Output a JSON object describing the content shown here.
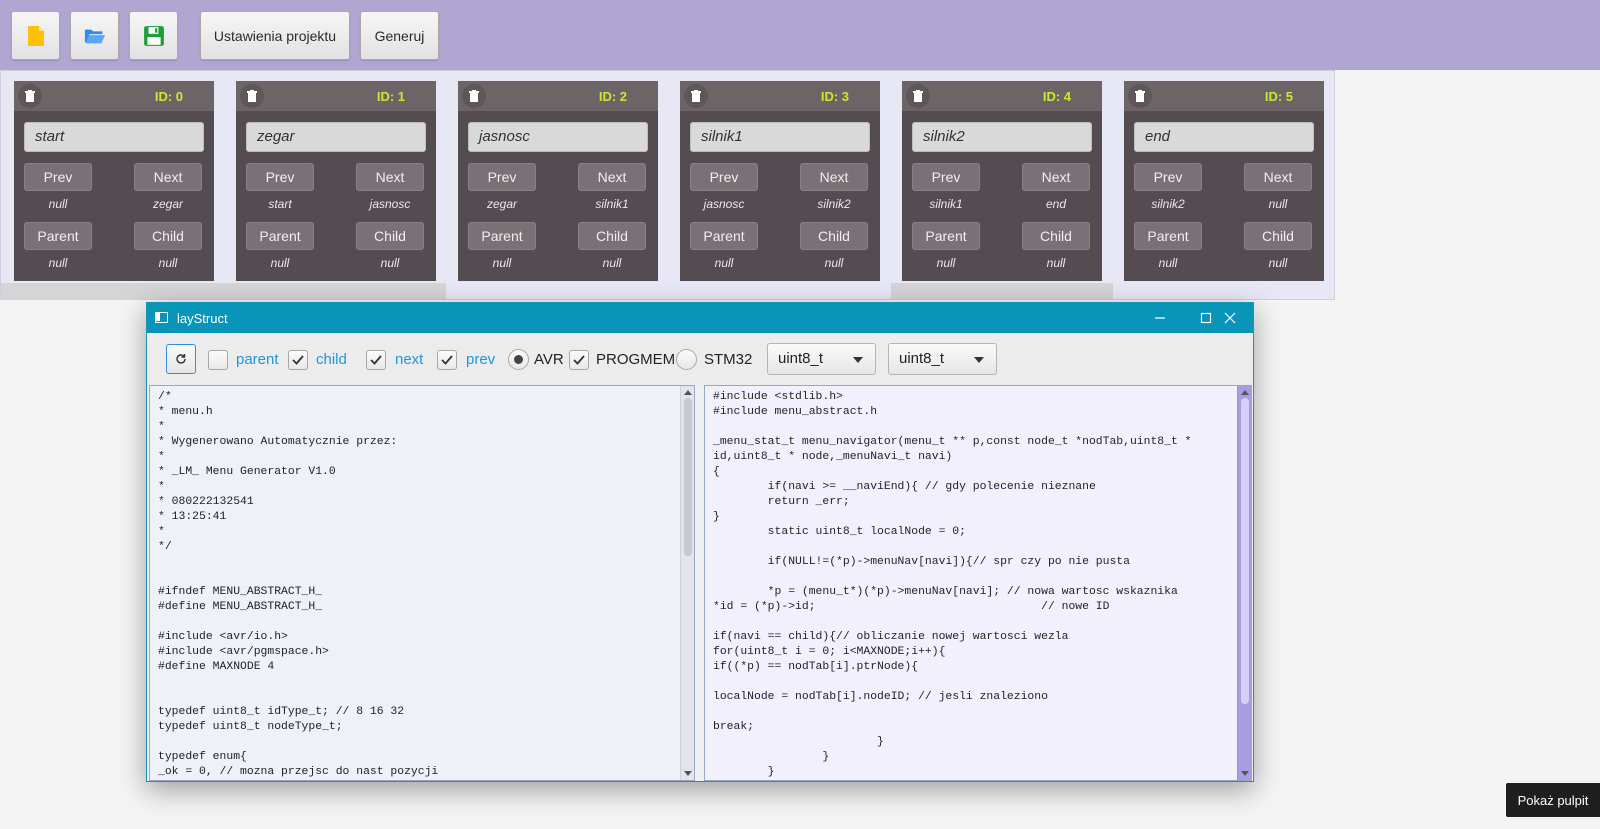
{
  "toolbar": {
    "new_icon_color": "#ffc107",
    "open_icon_color": "#2d8cf0",
    "save_icon_color": "#1e9e3a",
    "project_settings_label": "Ustawienia projektu",
    "generate_label": "Generuj"
  },
  "nodes": [
    {
      "id": "ID: 0",
      "name": "start",
      "prev_label": "Prev",
      "next_label": "Next",
      "prev": "null",
      "next": "zegar",
      "parent_label": "Parent",
      "child_label": "Child",
      "parent": "null",
      "child": "null"
    },
    {
      "id": "ID: 1",
      "name": "zegar",
      "prev_label": "Prev",
      "next_label": "Next",
      "prev": "start",
      "next": "jasnosc",
      "parent_label": "Parent",
      "child_label": "Child",
      "parent": "null",
      "child": "null"
    },
    {
      "id": "ID: 2",
      "name": "jasnosc",
      "prev_label": "Prev",
      "next_label": "Next",
      "prev": "zegar",
      "next": "silnik1",
      "parent_label": "Parent",
      "child_label": "Child",
      "parent": "null",
      "child": "null"
    },
    {
      "id": "ID: 3",
      "name": "silnik1",
      "prev_label": "Prev",
      "next_label": "Next",
      "prev": "jasnosc",
      "next": "silnik2",
      "parent_label": "Parent",
      "child_label": "Child",
      "parent": "null",
      "child": "null"
    },
    {
      "id": "ID: 4",
      "name": "silnik2",
      "prev_label": "Prev",
      "next_label": "Next",
      "prev": "silnik1",
      "next": "end",
      "parent_label": "Parent",
      "child_label": "Child",
      "parent": "null",
      "child": "null"
    },
    {
      "id": "ID: 5",
      "name": "end",
      "prev_label": "Prev",
      "next_label": "Next",
      "prev": "silnik2",
      "next": "null",
      "parent_label": "Parent",
      "child_label": "Child",
      "parent": "null",
      "child": "null"
    }
  ],
  "window": {
    "title": "layStruct",
    "options": {
      "parent": {
        "label": "parent",
        "checked": false
      },
      "child": {
        "label": "child",
        "checked": true
      },
      "next": {
        "label": "next",
        "checked": true
      },
      "prev": {
        "label": "prev",
        "checked": true
      },
      "avr": {
        "label": "AVR",
        "selected": true
      },
      "progmem": {
        "label": "PROGMEM",
        "checked": true
      },
      "stm32": {
        "label": "STM32",
        "selected": false
      }
    },
    "id_type_select": "uint8_t",
    "node_type_select": "uint8_t",
    "left_code": "/*\n* menu.h\n*\n* Wygenerowano Automatycznie przez:\n*\n* _LM_ Menu Generator V1.0\n*\n* 080222132541\n* 13:25:41\n*\n*/\n\n\n#ifndef MENU_ABSTRACT_H_\n#define MENU_ABSTRACT_H_\n\n#include <avr/io.h>\n#include <avr/pgmspace.h>\n#define MAXNODE 4\n\n\ntypedef uint8_t idType_t; // 8 16 32\ntypedef uint8_t nodeType_t;\n\ntypedef enum{\n_ok = 0, // mozna przejsc do nast pozycji",
    "right_code": "#include <stdlib.h>\n#include menu_abstract.h\n\n_menu_stat_t menu_navigator(menu_t ** p,const node_t *nodTab,uint8_t *\nid,uint8_t * node,_menuNavi_t navi)\n{\n        if(navi >= __naviEnd){ // gdy polecenie nieznane\n        return _err;\n}\n        static uint8_t localNode = 0;\n\n        if(NULL!=(*p)->menuNav[navi]){// spr czy po nie pusta\n\n        *p = (menu_t*)(*p)->menuNav[navi]; // nowa wartosc wskaznika\n*id = (*p)->id;                                 // nowe ID\n\nif(navi == child){// obliczanie nowej wartosci wezla\nfor(uint8_t i = 0; i<MAXNODE;i++){\nif((*p) == nodTab[i].ptrNode){\n\nlocalNode = nodTab[i].nodeID; // jesli znaleziono\n\nbreak;\n                        }\n                }\n        }"
  },
  "taskbar": {
    "show_desktop_label": "Pokaż pulpit"
  }
}
